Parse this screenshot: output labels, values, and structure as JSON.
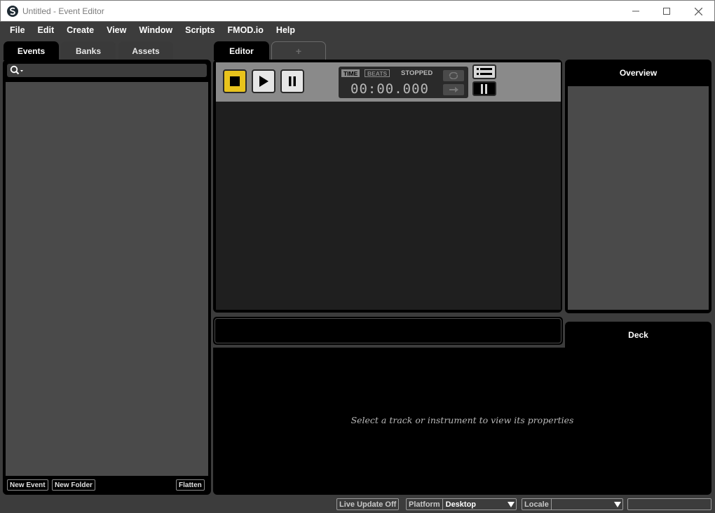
{
  "window": {
    "title": "Untitled - Event Editor",
    "icon": "fmod-logo-icon",
    "controls": [
      "minimize-icon",
      "maximize-icon",
      "close-icon"
    ]
  },
  "menu": {
    "items": [
      {
        "label": "File"
      },
      {
        "label": "Edit"
      },
      {
        "label": "Create"
      },
      {
        "label": "View"
      },
      {
        "label": "Window"
      },
      {
        "label": "Scripts"
      },
      {
        "label": "FMOD.io"
      },
      {
        "label": "Help"
      }
    ]
  },
  "browser": {
    "tabs": [
      {
        "label": "Events",
        "active": true
      },
      {
        "label": "Banks",
        "active": false
      },
      {
        "label": "Assets",
        "active": false
      }
    ],
    "search_icon": "search-icon",
    "buttons": {
      "new_event": "New Event",
      "new_folder": "New Folder",
      "flatten": "Flatten"
    }
  },
  "editor": {
    "tabs": [
      {
        "label": "Editor",
        "active": true
      },
      {
        "label": "+",
        "active": false
      }
    ],
    "transport": {
      "stop_icon": "stop-icon",
      "play_icon": "play-icon",
      "pause_icon": "pause-icon",
      "time_mode_time": "TIME",
      "time_mode_beats": "BEATS",
      "status": "STOPPED",
      "clock": "00:00.000",
      "loop_icon": "loop-icon",
      "next_icon": "arrow-right-icon",
      "list_icon": "list-icon",
      "split_icon": "split-view-icon"
    }
  },
  "overview": {
    "title": "Overview"
  },
  "deck": {
    "title": "Deck",
    "hint": "Select a track or instrument to view its properties"
  },
  "statusbar": {
    "live_update": "Live Update Off",
    "platform_label": "Platform",
    "platform_value": "Desktop",
    "locale_label": "Locale",
    "locale_value": ""
  },
  "colors": {
    "background": "#3c3c3c",
    "panel": "#000000",
    "list_bg": "#4a4a4a",
    "stop_accent": "#e8c31c"
  }
}
